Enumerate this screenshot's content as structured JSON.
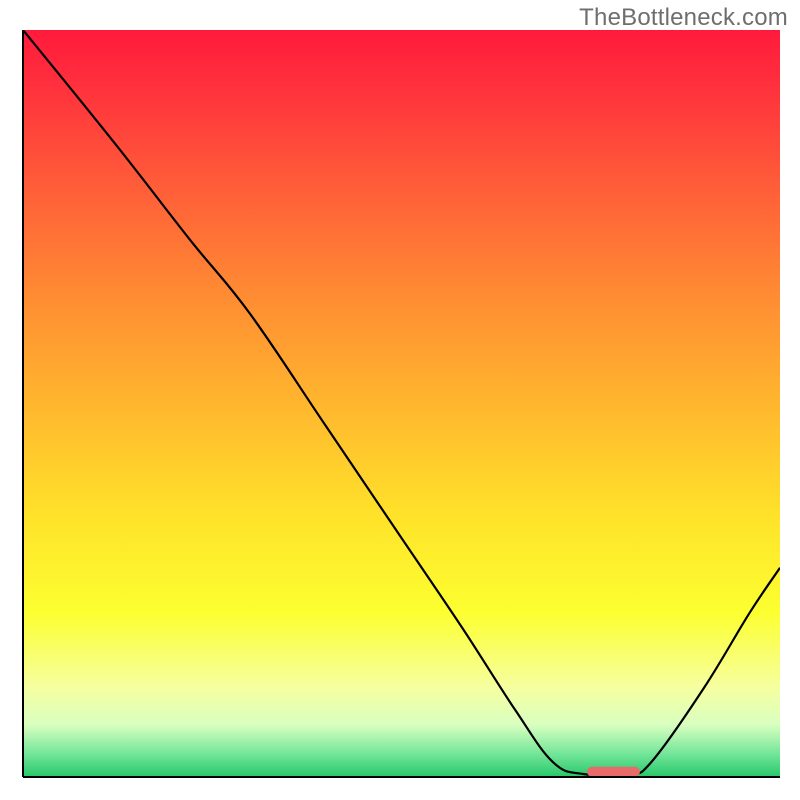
{
  "watermark": "TheBottleneck.com",
  "chart_data": {
    "type": "line",
    "title": "",
    "xlabel": "",
    "ylabel": "",
    "xlim": [
      0,
      100
    ],
    "ylim": [
      0,
      100
    ],
    "background_gradient": {
      "stops": [
        {
          "offset": 0.0,
          "color": "#ff1a3c"
        },
        {
          "offset": 0.07,
          "color": "#ff2f3d"
        },
        {
          "offset": 0.2,
          "color": "#ff5a39"
        },
        {
          "offset": 0.35,
          "color": "#ff8a33"
        },
        {
          "offset": 0.5,
          "color": "#ffb62e"
        },
        {
          "offset": 0.65,
          "color": "#ffe22a"
        },
        {
          "offset": 0.78,
          "color": "#fcff30"
        },
        {
          "offset": 0.88,
          "color": "#f6ffa0"
        },
        {
          "offset": 0.93,
          "color": "#d9ffc0"
        },
        {
          "offset": 0.97,
          "color": "#70e598"
        },
        {
          "offset": 1.0,
          "color": "#28c76a"
        }
      ]
    },
    "series": [
      {
        "name": "bottleneck-curve",
        "points": [
          {
            "x": 0.0,
            "y": 100.0
          },
          {
            "x": 12.0,
            "y": 85.0
          },
          {
            "x": 22.0,
            "y": 72.0
          },
          {
            "x": 30.0,
            "y": 62.0
          },
          {
            "x": 40.0,
            "y": 47.0
          },
          {
            "x": 50.0,
            "y": 32.0
          },
          {
            "x": 58.0,
            "y": 20.0
          },
          {
            "x": 65.0,
            "y": 9.0
          },
          {
            "x": 70.0,
            "y": 2.0
          },
          {
            "x": 74.0,
            "y": 0.4
          },
          {
            "x": 80.0,
            "y": 0.4
          },
          {
            "x": 83.0,
            "y": 2.0
          },
          {
            "x": 90.0,
            "y": 12.0
          },
          {
            "x": 96.0,
            "y": 22.0
          },
          {
            "x": 100.0,
            "y": 28.0
          }
        ]
      }
    ],
    "marker": {
      "name": "optimal-range-marker",
      "x_start": 74.5,
      "x_end": 81.5,
      "y": 0.7,
      "color": "#e86a6a",
      "thickness": 10
    },
    "axes": {
      "left": true,
      "bottom": true,
      "color": "#000000",
      "width": 2
    }
  }
}
